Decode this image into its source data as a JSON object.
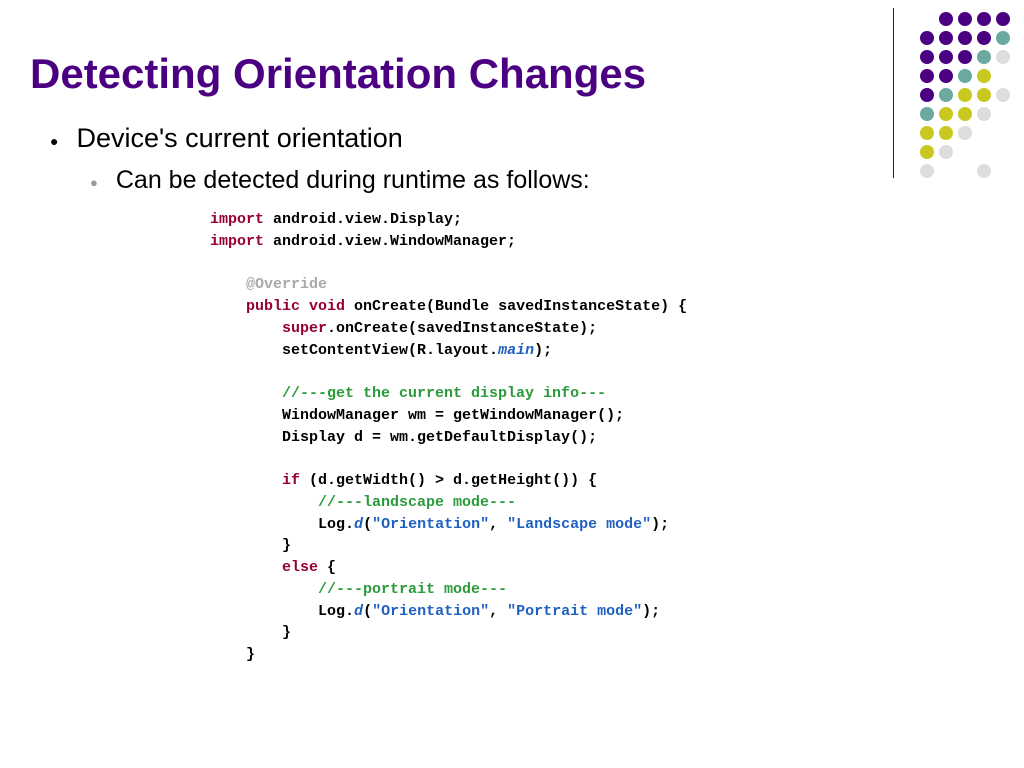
{
  "title": "Detecting Orientation Changes",
  "bullets": {
    "main": "Device's current orientation",
    "sub": "Can be detected during runtime as follows:"
  },
  "code": {
    "l1a": "import",
    "l1b": " android.view.Display;",
    "l2a": "import",
    "l2b": " android.view.WindowManager;",
    "l3": "@Override",
    "l4a": "public",
    "l4b": " void",
    "l4c": " onCreate(Bundle savedInstanceState) {",
    "l5a": "super",
    "l5b": ".onCreate(savedInstanceState);",
    "l6a": "setContentView(R.layout.",
    "l6b": "main",
    "l6c": ");",
    "l7": "//---get the current display info---",
    "l8": "WindowManager wm = getWindowManager();",
    "l9": "Display d = wm.getDefaultDisplay();",
    "l10a": "if",
    "l10b": " (d.getWidth() > d.getHeight()) {",
    "l11": "//---landscape mode---",
    "l12a": "Log.",
    "l12b": "d",
    "l12c": "(",
    "l12d": "\"Orientation\"",
    "l12e": ", ",
    "l12f": "\"Landscape mode\"",
    "l12g": ");",
    "l13": "}",
    "l14a": "else",
    "l14b": " {",
    "l15": "//---portrait mode---",
    "l16a": "Log.",
    "l16b": "d",
    "l16c": "(",
    "l16d": "\"Orientation\"",
    "l16e": ", ",
    "l16f": "\"Portrait mode\"",
    "l16g": ");",
    "l17": "}",
    "l18": "}"
  },
  "dots": [
    [
      "dn",
      "dp",
      "dp",
      "dp",
      "dp"
    ],
    [
      "dp",
      "dp",
      "dp",
      "dp",
      "dt"
    ],
    [
      "dp",
      "dp",
      "dp",
      "dt",
      "dg"
    ],
    [
      "dp",
      "dp",
      "dt",
      "dy",
      "dn"
    ],
    [
      "dp",
      "dt",
      "dy",
      "dy",
      "dg"
    ],
    [
      "dt",
      "dy",
      "dy",
      "dg",
      "dn"
    ],
    [
      "dy",
      "dy",
      "dg",
      "dn",
      "dn"
    ],
    [
      "dy",
      "dg",
      "dn",
      "dn",
      "dn"
    ],
    [
      "dg",
      "dn",
      "dn",
      "dg",
      "dn"
    ],
    [
      "dn",
      "dn",
      "dn",
      "dn",
      "dn"
    ]
  ]
}
